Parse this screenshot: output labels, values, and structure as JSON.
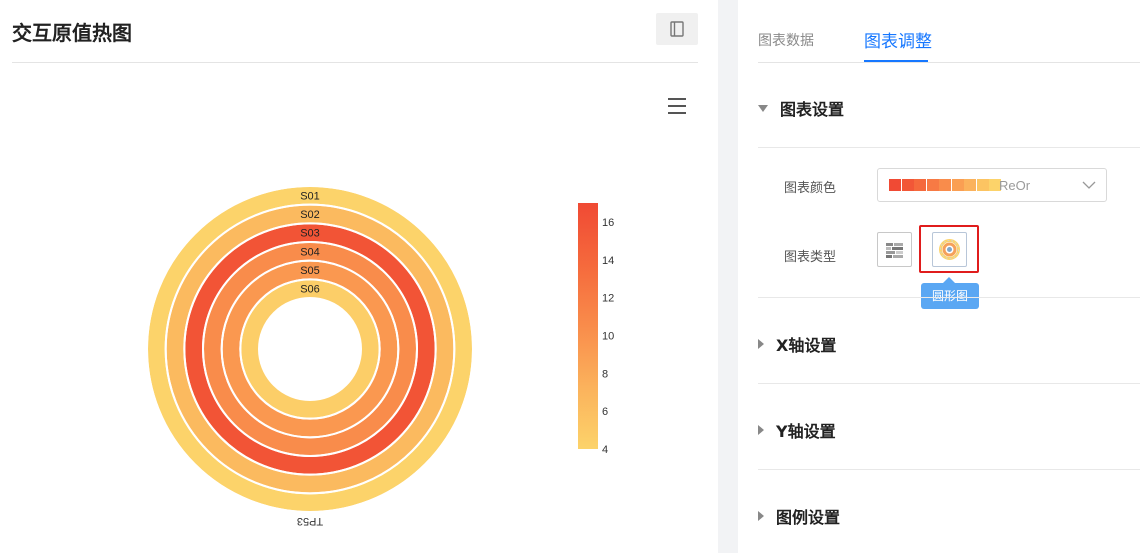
{
  "left": {
    "title": "交互原值热图",
    "doc_icon": "document-icon",
    "menu_icon": "hamburger-menu-icon"
  },
  "chart_data": {
    "type": "heatmap",
    "layout": "circular",
    "rings": [
      "S01",
      "S02",
      "S03",
      "S04",
      "S05",
      "S06"
    ],
    "categories": [
      "TP53"
    ],
    "values": [
      4,
      6.5,
      16,
      10.5,
      9.5,
      4.5
    ],
    "visual_map": {
      "min": 4,
      "max": 17,
      "ticks": [
        16,
        14,
        12,
        10,
        8,
        6,
        4
      ],
      "colors": [
        "#fcd36a",
        "#fbb25c",
        "#f98c4b",
        "#f5693c",
        "#f04a34"
      ]
    }
  },
  "right": {
    "tabs": [
      "图表数据",
      "图表调整"
    ],
    "active_tab": "图表调整",
    "sections": {
      "chart_settings": "图表设置",
      "x_axis": "X轴设置",
      "y_axis": "Y轴设置",
      "legend": "图例设置"
    },
    "fields": {
      "color_label": "图表颜色",
      "color_value": "ReOr",
      "color_swatches": [
        "#f04a34",
        "#f25737",
        "#f5693c",
        "#f77a44",
        "#f98c4b",
        "#fa9f53",
        "#fbb25c",
        "#fcc462",
        "#fcd36a"
      ],
      "type_label": "图表类型",
      "type_options": [
        "heatmap-grid-icon",
        "circle-heatmap-icon"
      ],
      "tooltip": "圆形图"
    }
  }
}
